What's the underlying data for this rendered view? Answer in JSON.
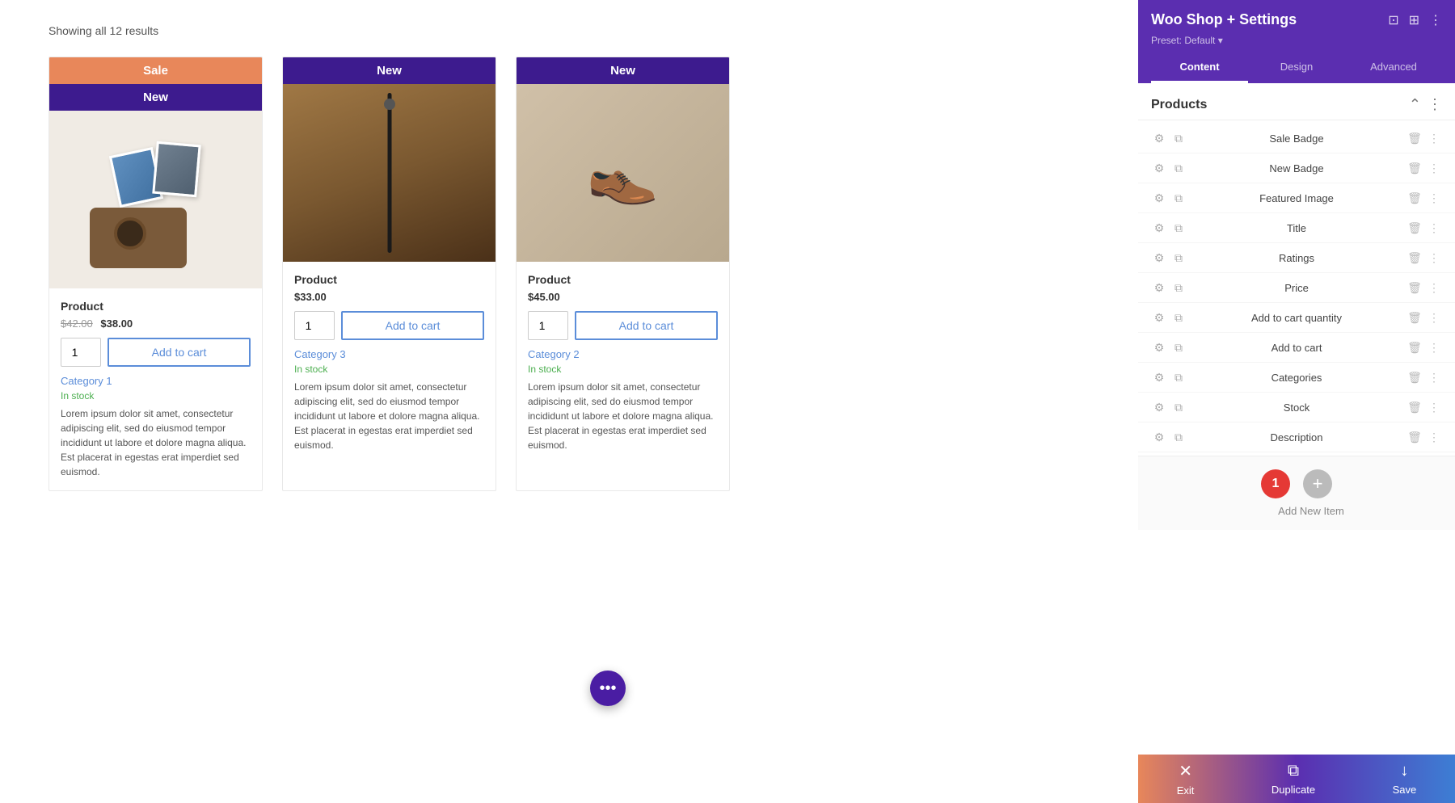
{
  "main": {
    "showing_results": "Showing all 12 results",
    "products": [
      {
        "id": "product-1",
        "badge_sale": "Sale",
        "badge_new": "New",
        "title": "Product",
        "price_old": "$42.00",
        "price_new": "$38.00",
        "qty": "1",
        "add_to_cart": "Add to cart",
        "category": "Category 1",
        "stock": "In stock",
        "description": "Lorem ipsum dolor sit amet, consectetur adipiscing elit, sed do eiusmod tempor incididunt ut labore et dolore magna aliqua. Est placerat in egestas erat imperdiet sed euismod.",
        "image_type": "camera-bag"
      },
      {
        "id": "product-2",
        "badge_new": "New",
        "title": "Product",
        "price": "$33.00",
        "qty": "1",
        "add_to_cart": "Add to cart",
        "category": "Category 3",
        "stock": "In stock",
        "description": "Lorem ipsum dolor sit amet, consectetur adipiscing elit, sed do eiusmod tempor incididunt ut labore et dolore magna aliqua. Est placerat in egestas erat imperdiet sed euismod.",
        "image_type": "zipper-bag"
      },
      {
        "id": "product-3",
        "badge_new": "New",
        "title": "Product",
        "price": "$45.00",
        "qty": "1",
        "add_to_cart": "Add to cart",
        "category": "Category 2",
        "stock": "In stock",
        "description": "Lorem ipsum dolor sit amet, consectetur adipiscing elit, sed do eiusmod tempor incididunt ut labore et dolore magna aliqua. Est placerat in egestas erat imperdiet sed euismod.",
        "image_type": "shoes"
      }
    ],
    "fab_dots": "•••"
  },
  "panel": {
    "title": "Woo Shop + Settings",
    "preset": "Preset: Default",
    "tabs": [
      {
        "id": "content",
        "label": "Content",
        "active": true
      },
      {
        "id": "design",
        "label": "Design",
        "active": false
      },
      {
        "id": "advanced",
        "label": "Advanced",
        "active": false
      }
    ],
    "section_title": "Products",
    "items": [
      {
        "id": "sale-badge",
        "label": "Sale Badge"
      },
      {
        "id": "new-badge",
        "label": "New Badge"
      },
      {
        "id": "featured-image",
        "label": "Featured Image"
      },
      {
        "id": "title",
        "label": "Title"
      },
      {
        "id": "ratings",
        "label": "Ratings"
      },
      {
        "id": "price",
        "label": "Price"
      },
      {
        "id": "add-to-cart-quantity",
        "label": "Add to cart quantity"
      },
      {
        "id": "add-to-cart",
        "label": "Add to cart"
      },
      {
        "id": "categories",
        "label": "Categories"
      },
      {
        "id": "stock",
        "label": "Stock"
      },
      {
        "id": "description",
        "label": "Description"
      }
    ],
    "notification_count": "1",
    "add_new_item_label": "Add New Item",
    "add_icon": "+",
    "bottom_buttons": [
      {
        "id": "exit",
        "label": "Exit",
        "icon": "✕"
      },
      {
        "id": "duplicate",
        "label": "Duplicate",
        "icon": "⧉"
      },
      {
        "id": "save",
        "label": "Save",
        "icon": "↓"
      }
    ]
  }
}
